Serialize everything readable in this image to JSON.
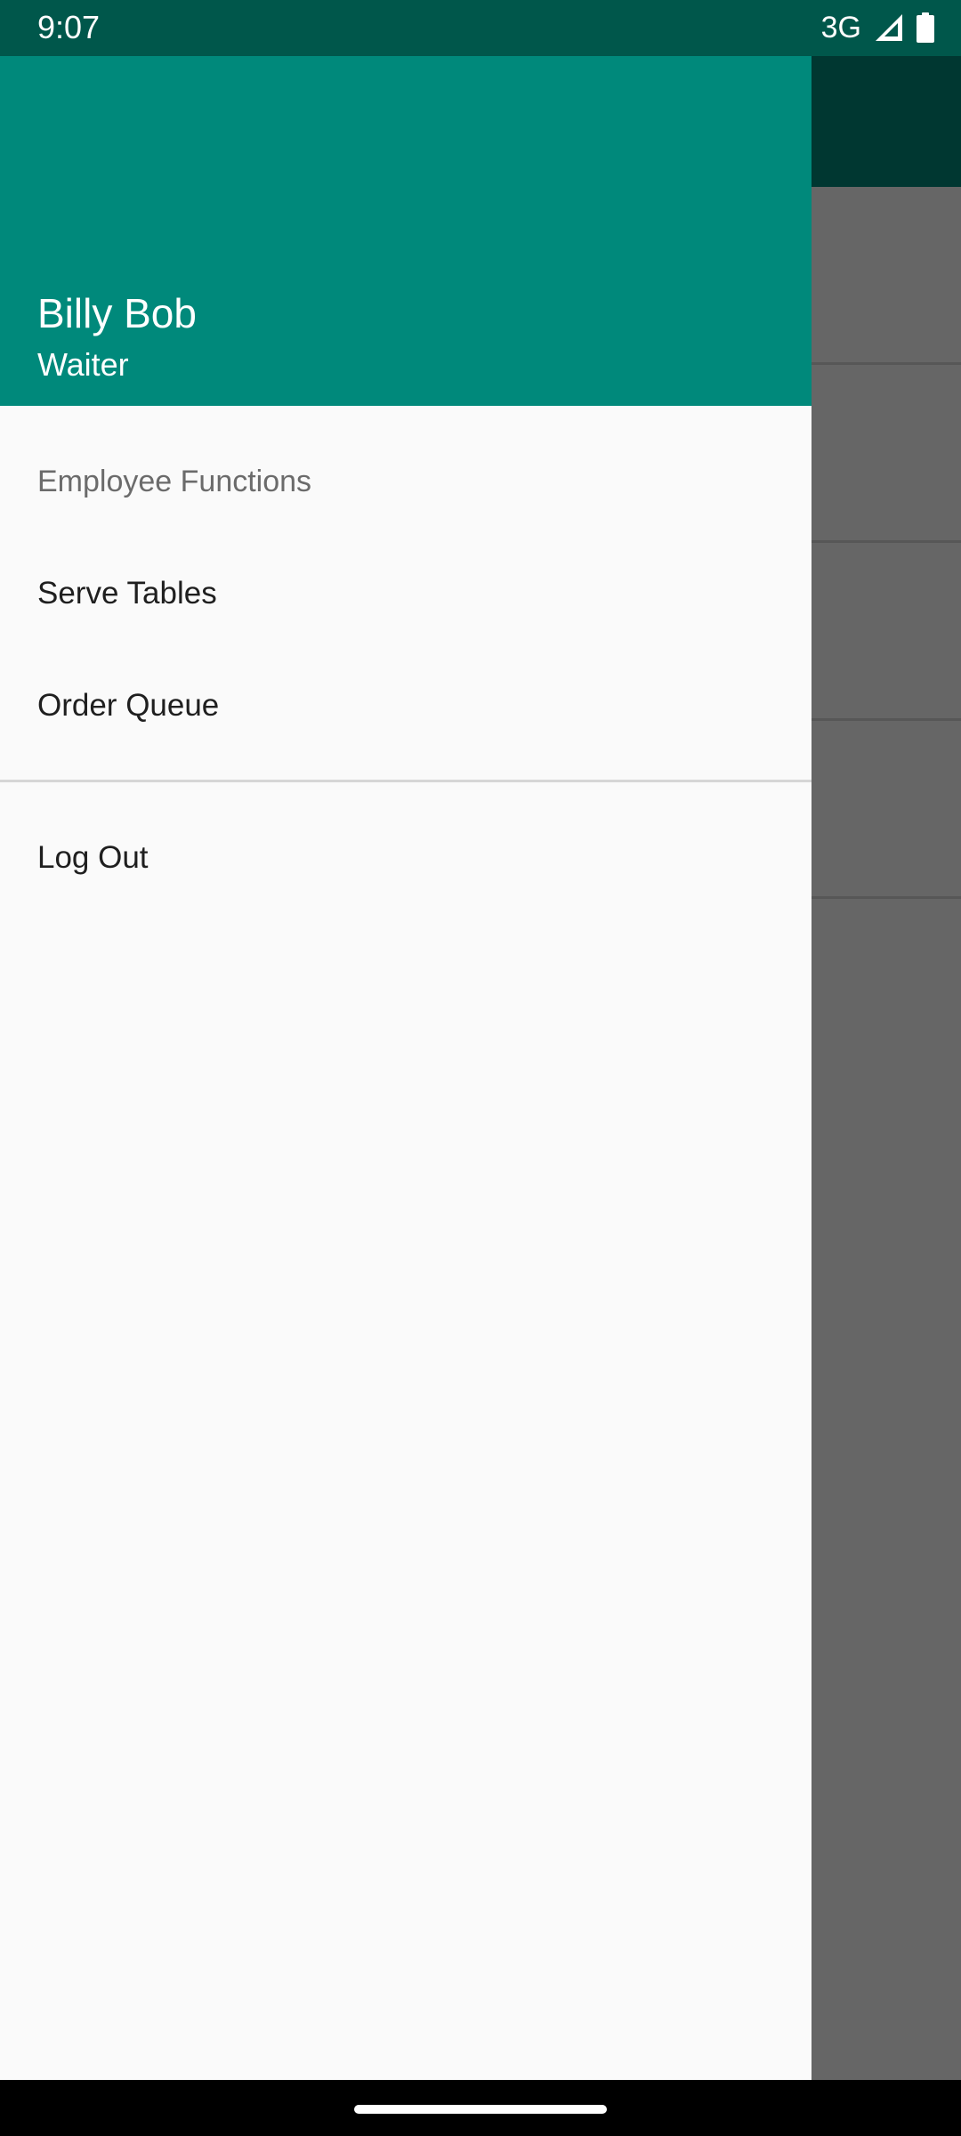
{
  "status_bar": {
    "time": "9:07",
    "network": "3G",
    "icons": [
      "signal-icon",
      "battery-icon"
    ]
  },
  "drawer": {
    "header": {
      "name": "Billy Bob",
      "role": "Waiter"
    },
    "section_title": "Employee Functions",
    "items": [
      {
        "label": "Serve Tables"
      },
      {
        "label": "Order Queue"
      }
    ],
    "logout_label": "Log Out"
  },
  "colors": {
    "primary": "#00897b",
    "primary_dark": "#00574b",
    "drawer_background": "#fafafa",
    "section_text": "#6b6b6b",
    "item_text": "#1f1f1f"
  }
}
